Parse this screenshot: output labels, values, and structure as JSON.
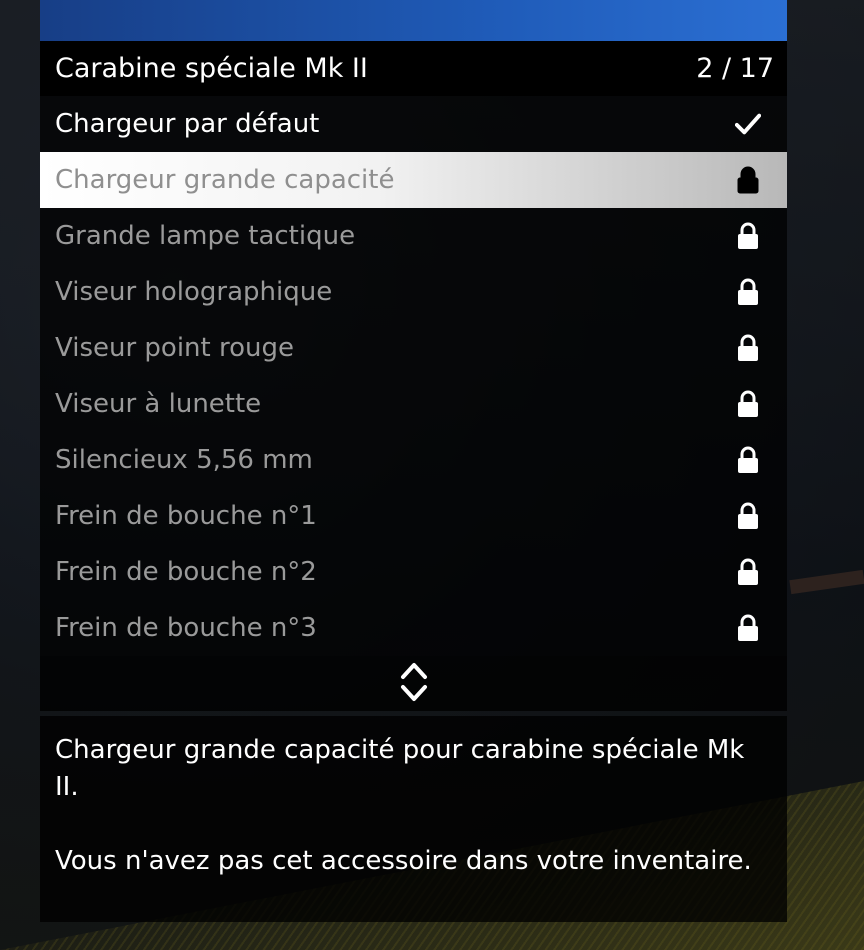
{
  "menu": {
    "subtitle": "Carabine spéciale Mk II",
    "counter": "2 / 17",
    "items": [
      {
        "label": "Chargeur par défaut",
        "status": "check-icon",
        "state": "enabled"
      },
      {
        "label": "Chargeur grande capacité",
        "status": "lock-icon",
        "state": "selected"
      },
      {
        "label": "Grande lampe tactique",
        "status": "lock-icon",
        "state": "locked"
      },
      {
        "label": "Viseur holographique",
        "status": "lock-icon",
        "state": "locked"
      },
      {
        "label": "Viseur point rouge",
        "status": "lock-icon",
        "state": "locked"
      },
      {
        "label": "Viseur à lunette",
        "status": "lock-icon",
        "state": "locked"
      },
      {
        "label": "Silencieux 5,56 mm",
        "status": "lock-icon",
        "state": "locked"
      },
      {
        "label": "Frein de bouche n°1",
        "status": "lock-icon",
        "state": "locked"
      },
      {
        "label": "Frein de bouche n°2",
        "status": "lock-icon",
        "state": "locked"
      },
      {
        "label": "Frein de bouche n°3",
        "status": "lock-icon",
        "state": "locked"
      }
    ],
    "scroll_icon": "up-down-chevrons-icon"
  },
  "description": {
    "line1": "Chargeur grande capacité pour carabine spéciale Mk II.",
    "line2": "Vous n'avez pas cet accessoire dans votre inventaire."
  },
  "colors": {
    "banner": "#1f5bb8",
    "selected_bg": "#ffffff",
    "locked_text": "#9a9a9a"
  }
}
